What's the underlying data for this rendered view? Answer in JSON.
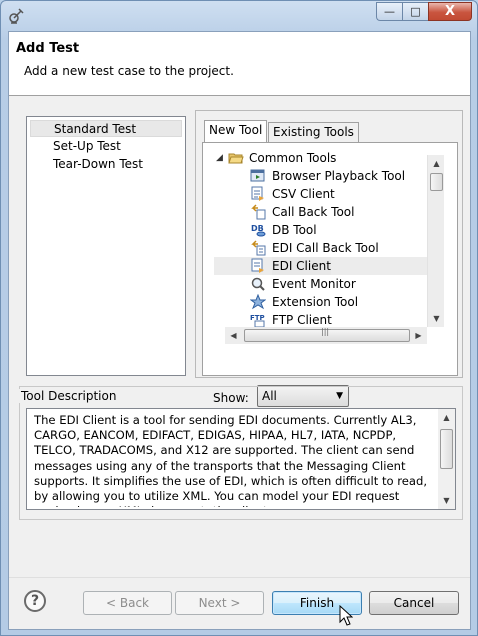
{
  "window": {
    "controls": {
      "minimize": "—",
      "maximize": "□",
      "close": "X"
    }
  },
  "header": {
    "title": "Add Test",
    "subtitle": "Add a new test case to the project."
  },
  "test_types": [
    {
      "label": "Standard Test",
      "selected": true
    },
    {
      "label": "Set-Up Test",
      "selected": false
    },
    {
      "label": "Tear-Down Test",
      "selected": false
    }
  ],
  "tabs": [
    {
      "label": "New Tool",
      "active": true
    },
    {
      "label": "Existing Tools",
      "active": false
    }
  ],
  "tree": {
    "root": {
      "label": "Common Tools",
      "expanded": true,
      "icon": "folder-open-icon"
    },
    "items": [
      {
        "label": "Browser Playback Tool",
        "icon": "browser-playback-icon",
        "selected": false
      },
      {
        "label": "CSV Client",
        "icon": "csv-client-icon",
        "selected": false
      },
      {
        "label": "Call Back Tool",
        "icon": "call-back-icon",
        "selected": false
      },
      {
        "label": "DB Tool",
        "icon": "db-tool-icon",
        "selected": false
      },
      {
        "label": "EDI Call Back Tool",
        "icon": "edi-call-back-icon",
        "selected": false
      },
      {
        "label": "EDI Client",
        "icon": "edi-client-icon",
        "selected": true
      },
      {
        "label": "Event Monitor",
        "icon": "event-monitor-icon",
        "selected": false
      },
      {
        "label": "Extension Tool",
        "icon": "extension-tool-icon",
        "selected": false
      },
      {
        "label": "FTP Client",
        "icon": "ftp-client-icon",
        "selected": false
      }
    ]
  },
  "show_filter": {
    "label": "Show:",
    "selected": "All"
  },
  "tool_description": {
    "title": "Tool Description",
    "text": "The EDI Client is a tool for sending EDI documents.  Currently AL3, CARGO, EANCOM, EDIFACT, EDIGAS, HIPAA, HL7, IATA, NCPDP, TELCO, TRADACOMS, and X12 are supported.  The client can send messages using any of the transports that the Messaging Client supports.  It simplifies the use of EDI, which is often difficult to read, by allowing you to utilize XML.  You can model your EDI request payload as an XML document; the client"
  },
  "buttons": {
    "back": "< Back",
    "next": "Next >",
    "finish": "Finish",
    "cancel": "Cancel",
    "help": "?"
  }
}
